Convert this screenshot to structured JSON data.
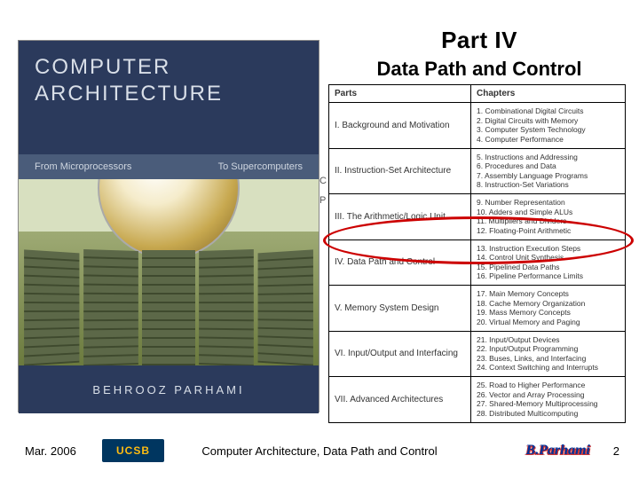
{
  "heading": {
    "part": "Part IV",
    "title": "Data Path and Control"
  },
  "book": {
    "title_line1": "COMPUTER",
    "title_line2": "ARCHITECTURE",
    "band_left": "From Microprocessors",
    "band_right": "To Supercomputers",
    "author": "BEHROOZ PARHAMI"
  },
  "toc": {
    "header_parts": "Parts",
    "header_chapters": "Chapters",
    "rows": [
      {
        "part": "I. Background and Motivation",
        "chapters": "1. Combinational Digital Circuits\n2. Digital Circuits with Memory\n3. Computer System Technology\n4. Computer Performance"
      },
      {
        "part": "II. Instruction-Set Architecture",
        "chapters": "5. Instructions and Addressing\n6. Procedures and Data\n7. Assembly Language Programs\n8. Instruction-Set Variations"
      },
      {
        "part": "III. The Arithmetic/Logic Unit",
        "chapters": "9. Number Representation\n10. Adders and Simple ALUs\n11. Multipliers and Dividers\n12. Floating-Point Arithmetic"
      },
      {
        "part": "IV. Data Path and Control",
        "chapters": "13. Instruction Execution Steps\n14. Control Unit Synthesis\n15. Pipelined Data Paths\n16. Pipeline Performance Limits"
      },
      {
        "part": "V. Memory System Design",
        "chapters": "17. Main Memory Concepts\n18. Cache Memory Organization\n19. Mass Memory Concepts\n20. Virtual Memory and Paging"
      },
      {
        "part": "VI. Input/Output and Interfacing",
        "chapters": "21. Input/Output Devices\n22. Input/Output Programming\n23. Buses, Links, and Interfacing\n24. Context Switching and Interrupts"
      },
      {
        "part": "VII. Advanced Architectures",
        "chapters": "25. Road to Higher Performance\n26. Vector and Array Processing\n27. Shared-Memory Multiprocessing\n28. Distributed Multicomputing"
      }
    ]
  },
  "edge_letters": {
    "c": "C",
    "p": "P"
  },
  "footer": {
    "date": "Mar. 2006",
    "logo_text": "UCSB",
    "center": "Computer Architecture, Data Path and Control",
    "author": "B.Parhami",
    "page": "2"
  }
}
